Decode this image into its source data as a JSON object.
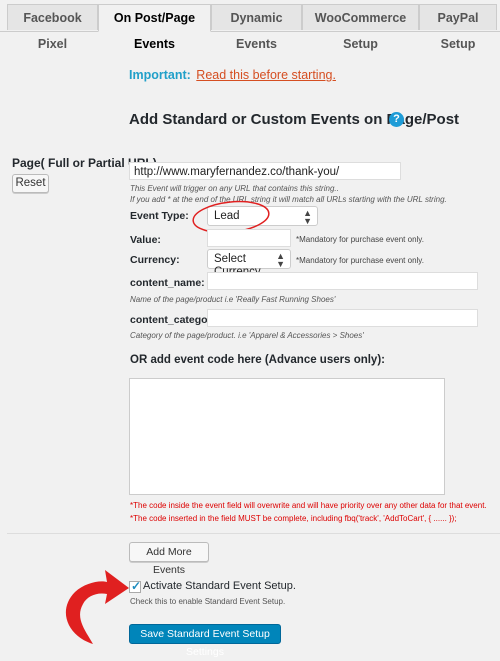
{
  "tabs": [
    {
      "label": "Facebook Pixel"
    },
    {
      "label": "On Post/Page Events"
    },
    {
      "label": "Dynamic Events"
    },
    {
      "label": "WooCommerce Setup"
    },
    {
      "label": "PayPal Setup"
    }
  ],
  "important": {
    "prefix": "Important:",
    "link": "Read this before starting."
  },
  "section_title": "Add Standard or Custom Events on Page/Post",
  "page_label": "Page( Full or Partial URL)",
  "reset_label": "Reset",
  "url": {
    "value": "http://www.maryfernandez.co/thank-you/",
    "hint1": "This Event will trigger on any URL that contains this string..",
    "hint2": "If you add * at the end of the URL string it will match all URLs starting with the URL string."
  },
  "event_type": {
    "label": "Event Type:",
    "value": "Lead"
  },
  "value_field": {
    "label": "Value:",
    "value": "",
    "note": "*Mandatory for purchase event only."
  },
  "currency": {
    "label": "Currency:",
    "value": "Select Currency",
    "note": "*Mandatory for purchase event only."
  },
  "content_name": {
    "label": "content_name:",
    "value": "",
    "hint": "Name of the page/product i.e 'Really Fast Running Shoes'"
  },
  "content_category": {
    "label": "content_category:",
    "value": "",
    "hint": "Category of the page/product. i.e 'Apparel & Accessories > Shoes'"
  },
  "event_code": {
    "heading": "OR add event code here (Advance users only):",
    "value": "",
    "note1": "*The code inside the event field will overwrite and will have priority over any other data for that event.",
    "note2": "*The code inserted in the field MUST be complete, including fbq('track', 'AddToCart', { ...... });"
  },
  "add_more_label": "Add More Events",
  "activate": {
    "label": "Activate Standard Event Setup.",
    "hint": "Check this to enable Standard Event Setup.",
    "checked": true
  },
  "save_label": "Save Standard Event Setup Settings",
  "colors": {
    "accent": "#21a0c9",
    "link": "#d54e21",
    "primary": "#0085ba",
    "annotation": "#e02020"
  }
}
